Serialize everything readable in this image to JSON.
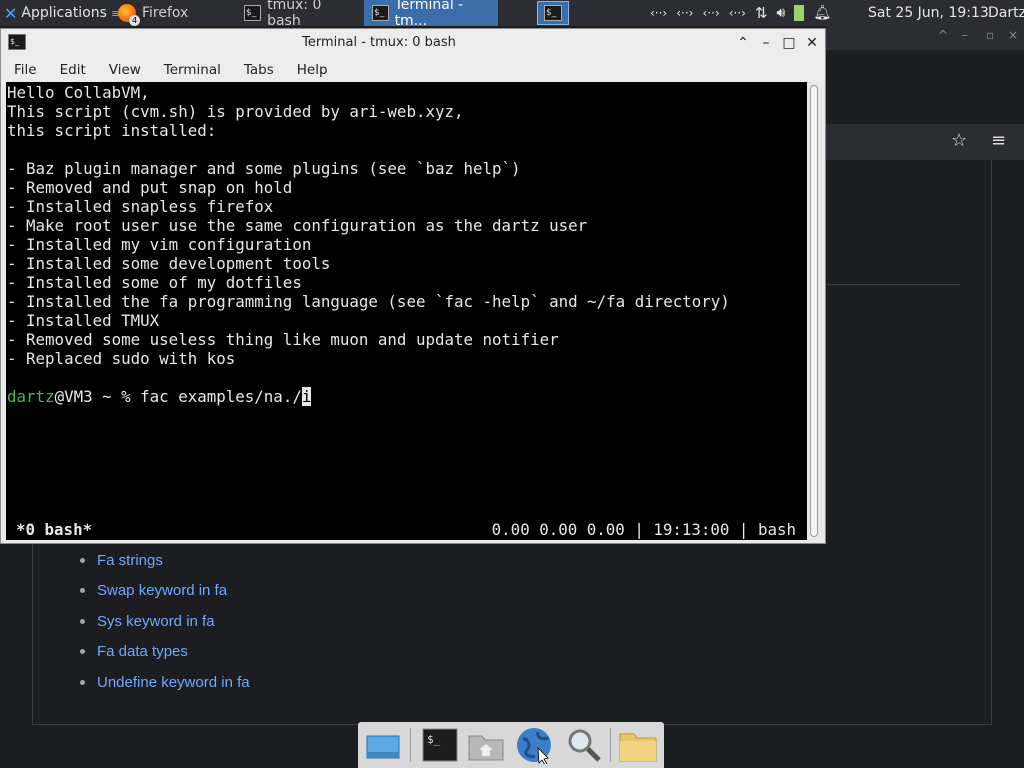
{
  "panel": {
    "applications_label": "Applications",
    "tasks": [
      {
        "label": "Firefox",
        "badge": "4"
      },
      {
        "label": "tmux: 0 bash"
      },
      {
        "label": "Terminal - tm..."
      }
    ],
    "clock": "Sat 25 Jun, 19:13",
    "user": "Dartz"
  },
  "terminal": {
    "title": "Terminal - tmux: 0 bash",
    "menu": [
      "File",
      "Edit",
      "View",
      "Terminal",
      "Tabs",
      "Help"
    ],
    "lines": [
      "Hello CollabVM,",
      "This script (cvm.sh) is provided by ari-web.xyz,",
      "this script installed:",
      "",
      "- Baz plugin manager and some plugins (see `baz help`)",
      "- Removed and put snap on hold",
      "- Installed snapless firefox",
      "- Make root user use the same configuration as the dartz user",
      "- Installed my vim configuration",
      "- Installed some development tools",
      "- Installed some of my dotfiles",
      "- Installed the fa programming language (see `fac -help` and ~/fa directory)",
      "- Installed TMUX",
      "- Removed some useless thing like muon and update notifier",
      "- Replaced sudo with kos",
      ""
    ],
    "prompt": {
      "user": "dartz",
      "rest": "@VM3 ~ % fac examples/na./",
      "cursor_char": "i"
    },
    "status_left": "*0 bash*",
    "status_right": "0.00 0.00 0.00 | 19:13:00 | bash"
  },
  "browser_links": [
    "Fa strings",
    "Swap keyword in fa",
    "Sys keyword in fa",
    "Fa data types",
    "Undefine keyword in fa"
  ],
  "icons": {
    "tray": [
      "network-icon",
      "network-icon",
      "network-icon",
      "network-icon",
      "transfer-icon",
      "volume-icon",
      "battery-icon",
      "notification-bell-icon"
    ],
    "dock": [
      "show-desktop-icon",
      "terminal-icon",
      "home-folder-icon",
      "web-browser-icon",
      "search-icon",
      "folder-icon"
    ]
  },
  "colors": {
    "link": "#6ea8ff",
    "prompt_user": "#4cb54c",
    "active_task": "#3b6ea8"
  }
}
